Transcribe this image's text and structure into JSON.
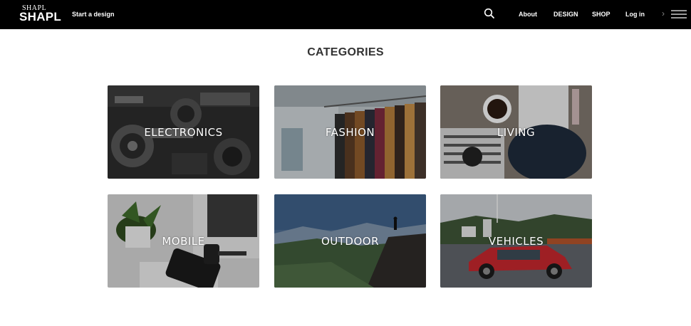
{
  "header": {
    "logo_small": "SHAPL",
    "logo_big": "SHAPL",
    "start_design": "Start a design",
    "nav": {
      "about": "About",
      "design": "DESIGN",
      "shop": "SHOP",
      "login": "Log in"
    },
    "chevron": "›",
    "icons": [
      "search-icon",
      "hamburger-menu-icon"
    ]
  },
  "main": {
    "heading": "CATEGORIES",
    "categories": [
      {
        "label": "ELECTRONICS"
      },
      {
        "label": "FASHION"
      },
      {
        "label": "LIVING"
      },
      {
        "label": "MOBILE"
      },
      {
        "label": "OUTDOOR"
      },
      {
        "label": "VEHICLES"
      }
    ]
  },
  "colors": {
    "topbar": "#000000",
    "heading": "#333333",
    "background": "#ffffff"
  }
}
